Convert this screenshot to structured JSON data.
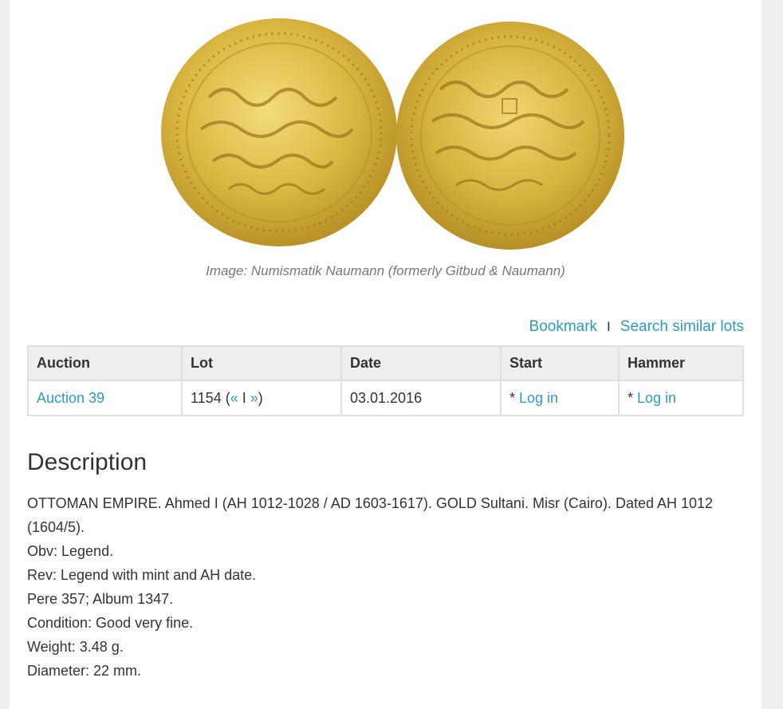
{
  "image": {
    "alt": "Gold Sultani coin obverse and reverse",
    "caption": "Image: Numismatik Naumann (formerly Gitbud & Naumann)"
  },
  "actions": {
    "bookmark": "Bookmark",
    "separator": "I",
    "search_similar": "Search similar lots"
  },
  "table": {
    "headers": [
      "Auction",
      "Lot",
      "Date",
      "Start",
      "Hammer"
    ],
    "row": {
      "auction": "Auction 39",
      "lot_number": "1154",
      "lot_open": " (",
      "prev": "«",
      "nav_sep": " I ",
      "next": "»",
      "lot_close": ")",
      "date": "03.01.2016",
      "start_prefix": "* ",
      "start_link": "Log in",
      "hammer_prefix": "* ",
      "hammer_link": "Log in"
    }
  },
  "description": {
    "title": "Description",
    "lines": [
      "OTTOMAN EMPIRE. Ahmed I (AH 1012-1028 / AD 1603-1617). GOLD Sultani. Misr (Cairo). Dated AH 1012 (1604/5).",
      "Obv: Legend.",
      "Rev: Legend with mint and AH date.",
      "Pere 357; Album 1347.",
      "Condition: Good very fine.",
      "Weight: 3.48 g.",
      "Diameter: 22 mm."
    ]
  },
  "colors": {
    "link": "#2a9bc4",
    "gold": "#d9b53a",
    "header_bg": "#eeeeee"
  }
}
